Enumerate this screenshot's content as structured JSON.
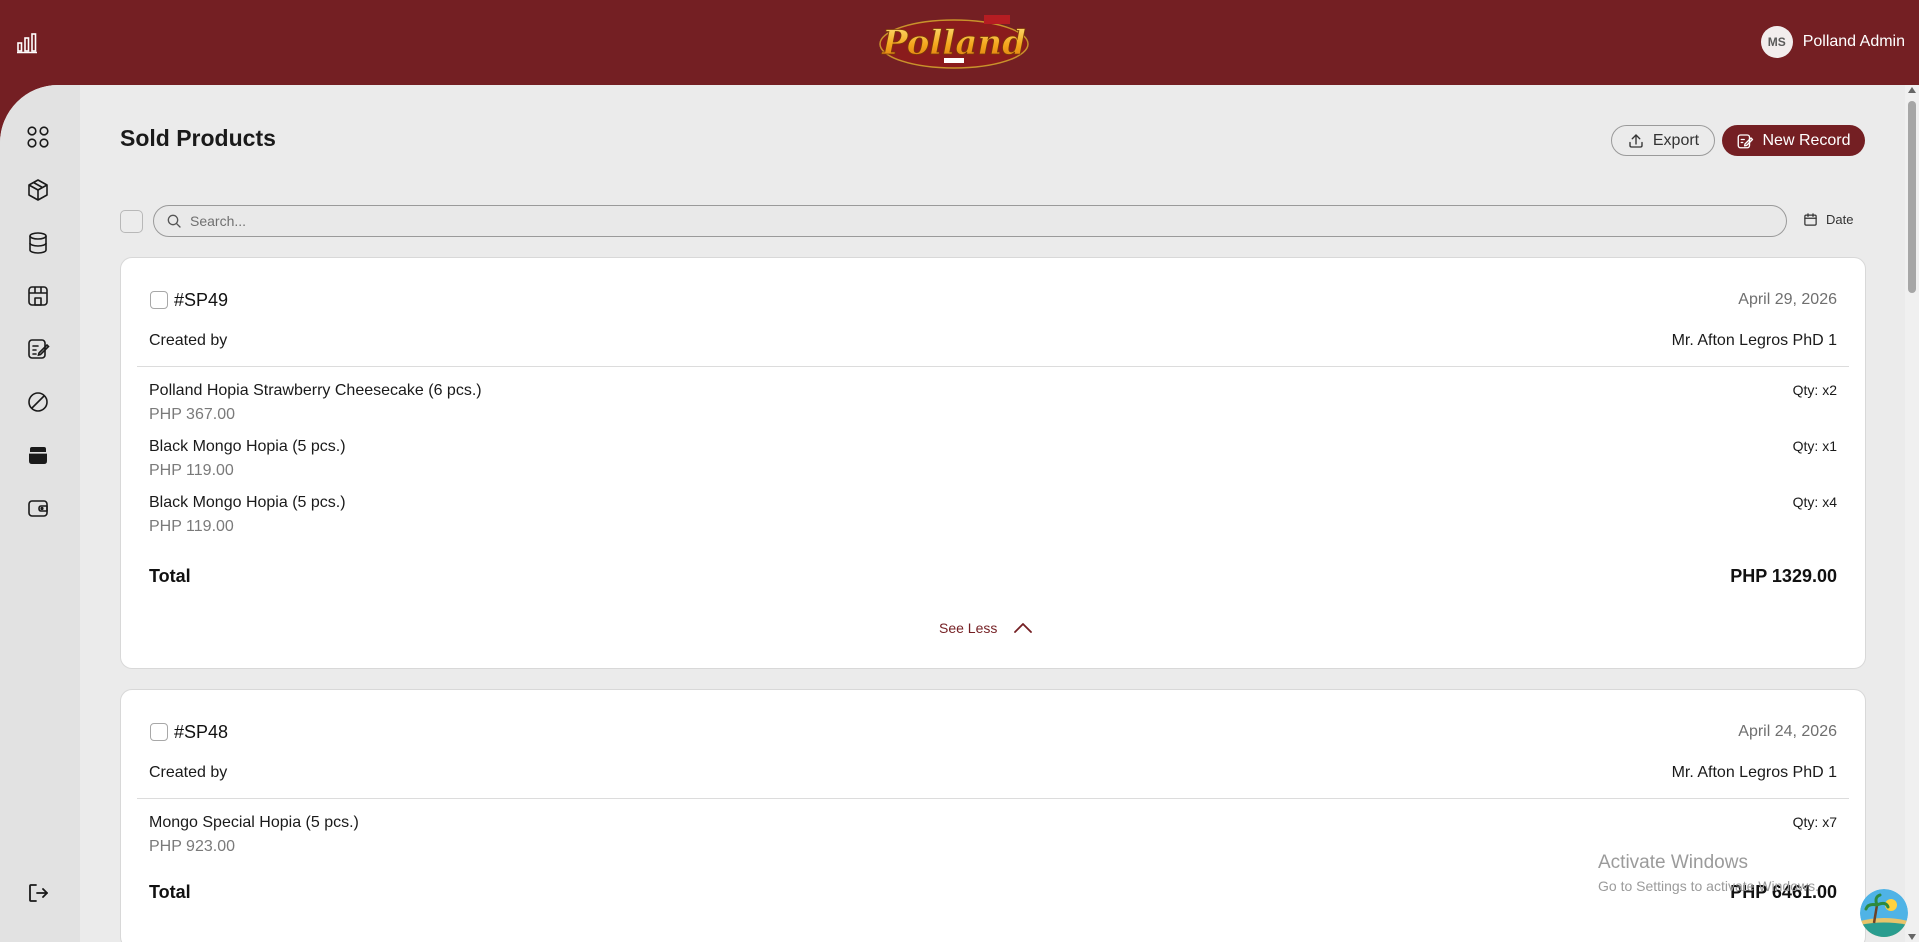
{
  "brand": {
    "logo_text": "Polland",
    "logo_tagline": "SINCE 1964",
    "primary_color": "#741f23",
    "background_color": "#ebebeb"
  },
  "header": {
    "user": {
      "initials": "MS",
      "name": "Polland Admin"
    }
  },
  "sidebar": {
    "items": [
      {
        "icon": "dashboard-grid-icon"
      },
      {
        "icon": "products-box-icon"
      },
      {
        "icon": "database-icon"
      },
      {
        "icon": "store-icon"
      },
      {
        "icon": "edit-records-icon"
      },
      {
        "icon": "ban-icon"
      },
      {
        "icon": "sold-products-basket-icon",
        "active": true
      },
      {
        "icon": "wallet-icon"
      }
    ],
    "logout_icon": "logout-icon"
  },
  "page": {
    "title": "Sold Products",
    "export_label": "Export",
    "new_record_label": "New Record",
    "search_placeholder": "Search...",
    "date_filter_label": "Date",
    "see_less_label": "See Less",
    "created_by_label": "Created by",
    "total_label": "Total"
  },
  "records": [
    {
      "id": "#SP49",
      "date": "April 29, 2026",
      "created_by": "Mr. Afton Legros PhD 1",
      "items": [
        {
          "name": "Polland Hopia Strawberry Cheesecake (6 pcs.)",
          "price": "PHP 367.00",
          "qty": "Qty: x2"
        },
        {
          "name": "Black Mongo Hopia (5 pcs.)",
          "price": "PHP 119.00",
          "qty": "Qty: x1"
        },
        {
          "name": "Black Mongo Hopia (5 pcs.)",
          "price": "PHP 119.00",
          "qty": "Qty: x4"
        }
      ],
      "total": "PHP 1329.00"
    },
    {
      "id": "#SP48",
      "date": "April 24, 2026",
      "created_by": "Mr. Afton Legros PhD 1",
      "items": [
        {
          "name": "Mongo Special Hopia (5 pcs.)",
          "price": "PHP 923.00",
          "qty": "Qty: x7"
        }
      ],
      "total": "PHP 6461.00"
    }
  ],
  "os_watermark": {
    "title": "Activate Windows",
    "subtitle": "Go to Settings to activate Windows."
  }
}
